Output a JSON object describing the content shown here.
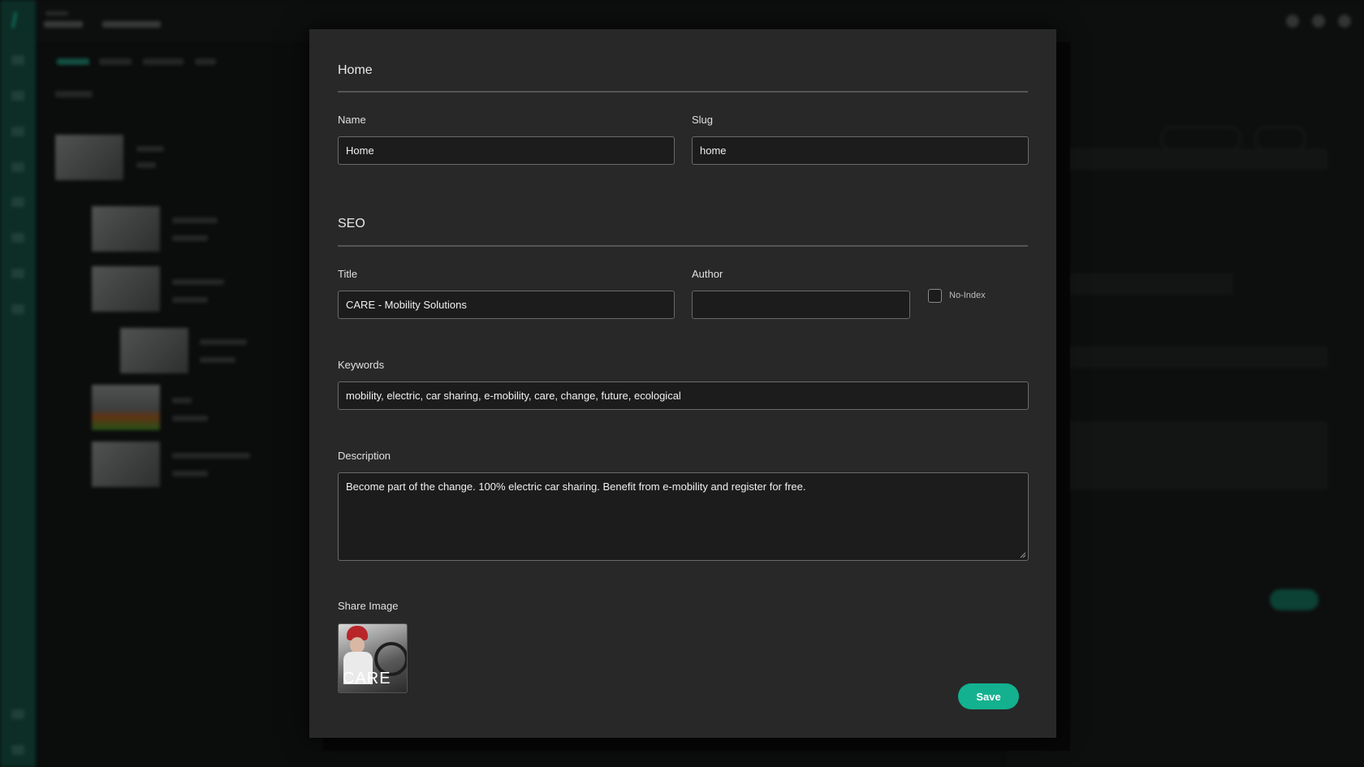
{
  "modal": {
    "page_section_title": "Home",
    "name": {
      "label": "Name",
      "value": "Home"
    },
    "slug": {
      "label": "Slug",
      "value": "home"
    },
    "seo_section_title": "SEO",
    "title": {
      "label": "Title",
      "value": "CARE - Mobility Solutions"
    },
    "author": {
      "label": "Author",
      "value": ""
    },
    "no_index": {
      "label": "No-Index",
      "checked": false
    },
    "keywords": {
      "label": "Keywords",
      "value": "mobility, electric, car sharing, e-mobility, care, change, future, ecological"
    },
    "description": {
      "label": "Description",
      "value": "Become part of the change. 100% electric car sharing. Benefit from e-mobility and register for free."
    },
    "share_image": {
      "label": "Share Image",
      "brand_text": "CARE"
    },
    "save_label": "Save"
  },
  "colors": {
    "accent": "#13b18f",
    "modal_background": "#282828",
    "sidebar": "#0d4a3c"
  }
}
